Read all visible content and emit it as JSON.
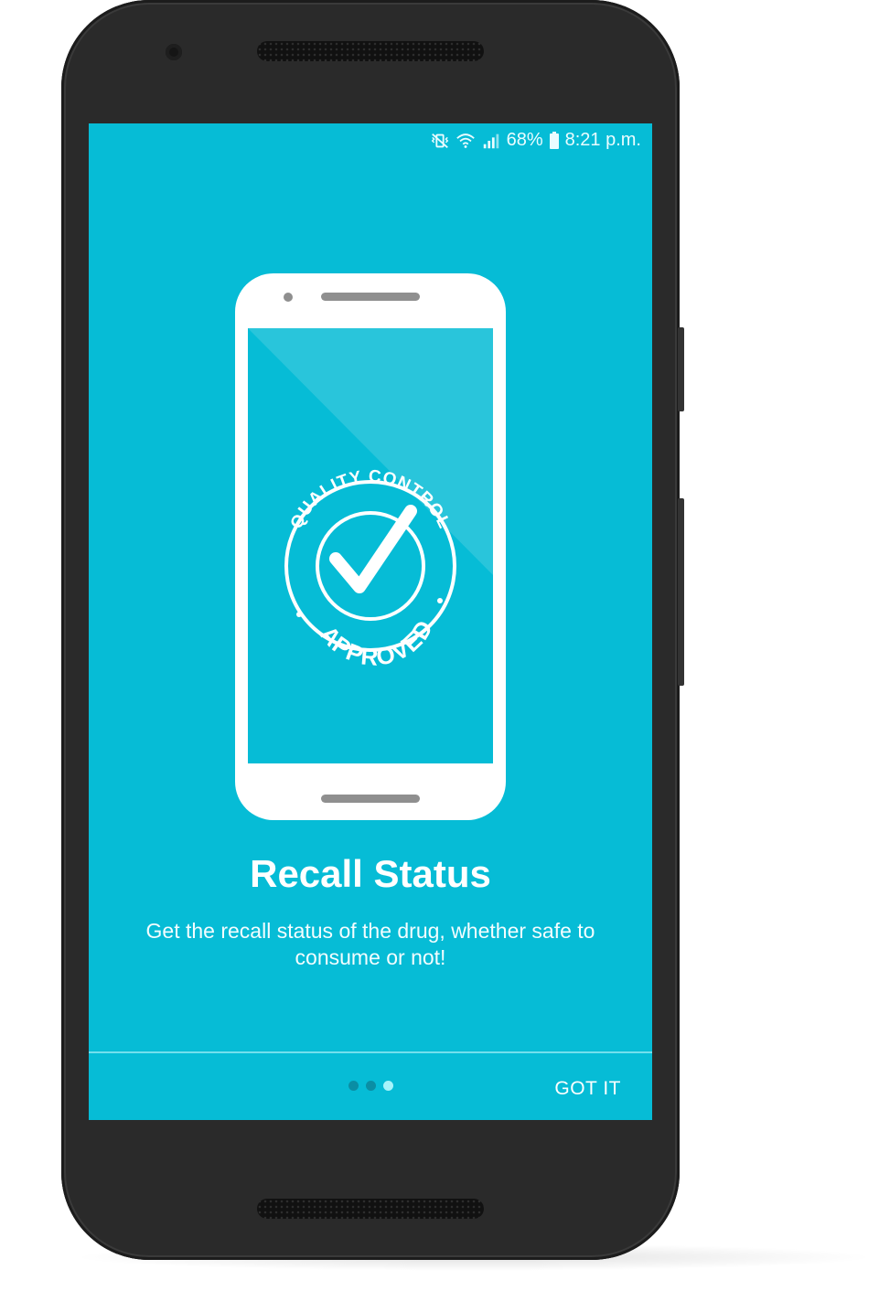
{
  "status_bar": {
    "battery": "68%",
    "time": "8:21 p.m.",
    "icons": [
      "vibrate-mute-icon",
      "wifi-icon",
      "signal-icon",
      "battery-icon"
    ]
  },
  "stamp": {
    "top_text": "QUALITY CONTROL",
    "bottom_text": "APPROVED"
  },
  "onboarding": {
    "title": "Recall Status",
    "description": "Get the recall status of the drug, whether safe to consume or not!",
    "page_count": 3,
    "active_page": 3,
    "got_it_label": "GOT IT"
  },
  "colors": {
    "screen_bg": "#06bcd6",
    "dot_inactive": "#0a8ea4",
    "dot_active": "#a7f4fb"
  }
}
